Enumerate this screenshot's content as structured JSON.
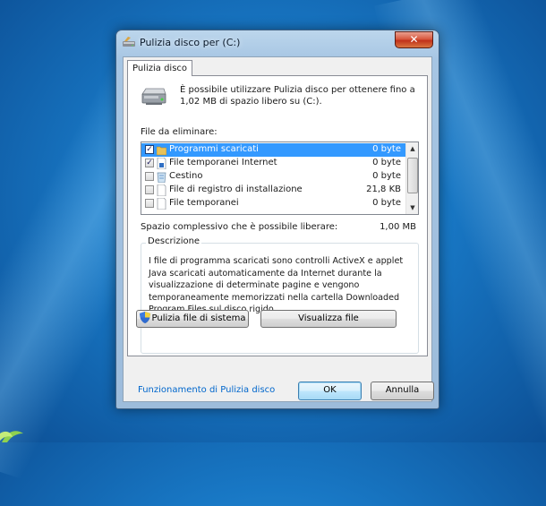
{
  "window": {
    "title": "Pulizia disco per  (C:)",
    "close_glyph": "✕"
  },
  "tabs": [
    {
      "label": "Pulizia disco"
    }
  ],
  "intro_text": "È possibile utilizzare Pulizia disco per ottenere fino a 1,02 MB di spazio libero su  (C:).",
  "files_label": "File da eliminare:",
  "files": [
    {
      "name": "Programmi scaricati",
      "size": "0 byte",
      "checked": true,
      "selected": true,
      "icon": "folder-icon",
      "check_glyph": "✓"
    },
    {
      "name": "File temporanei Internet",
      "size": "0 byte",
      "checked": true,
      "selected": false,
      "icon": "document-lock-icon",
      "check_glyph": "✓"
    },
    {
      "name": "Cestino",
      "size": "0 byte",
      "checked": false,
      "selected": false,
      "icon": "recycle-bin-icon",
      "check_glyph": ""
    },
    {
      "name": "File di registro di installazione",
      "size": "21,8 KB",
      "checked": false,
      "selected": false,
      "icon": "document-icon",
      "check_glyph": ""
    },
    {
      "name": "File temporanei",
      "size": "0 byte",
      "checked": false,
      "selected": false,
      "icon": "document-icon",
      "check_glyph": ""
    }
  ],
  "scroll": {
    "up_glyph": "▲",
    "down_glyph": "▼"
  },
  "total_label": "Spazio complessivo che è possibile liberare:",
  "total_value": "1,00 MB",
  "description": {
    "title": "Descrizione",
    "text": "I file di programma scaricati sono controlli ActiveX e applet Java scaricati automaticamente da Internet durante la visualizzazione di determinate pagine e vengono temporaneamente memorizzati nella cartella Downloaded Program Files sul disco rigido."
  },
  "buttons": {
    "system_cleanup": "Pulizia file di sistema",
    "view_files": "Visualizza file",
    "ok": "OK",
    "cancel": "Annulla"
  },
  "help_link": "Funzionamento di Pulizia disco",
  "colors": {
    "selection": "#3399ff",
    "link": "#0066cc",
    "close_button": "#c0311a"
  }
}
